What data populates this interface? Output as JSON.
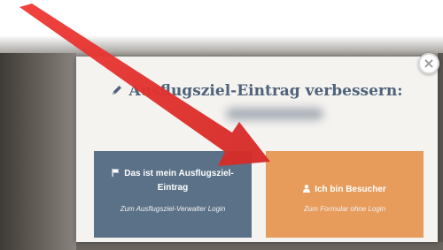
{
  "dialog": {
    "title": "Ausflugsziel-Eintrag verbessern:",
    "close_label": "×"
  },
  "options": {
    "owner": {
      "label": "Das ist mein Ausflugsziel-Eintrag",
      "sublabel": "Zum Ausflugsziel-Verwalter Login",
      "color": "#5a7187"
    },
    "visitor": {
      "label": "Ich bin Besucher",
      "sublabel": "Zum Formular ohne Login",
      "color": "#e79c5c"
    }
  },
  "annotation": {
    "arrow_color": "#e8322f"
  },
  "icons": [
    "pencil-icon",
    "flag-icon",
    "user-icon",
    "close-icon",
    "arrow-annotation"
  ]
}
